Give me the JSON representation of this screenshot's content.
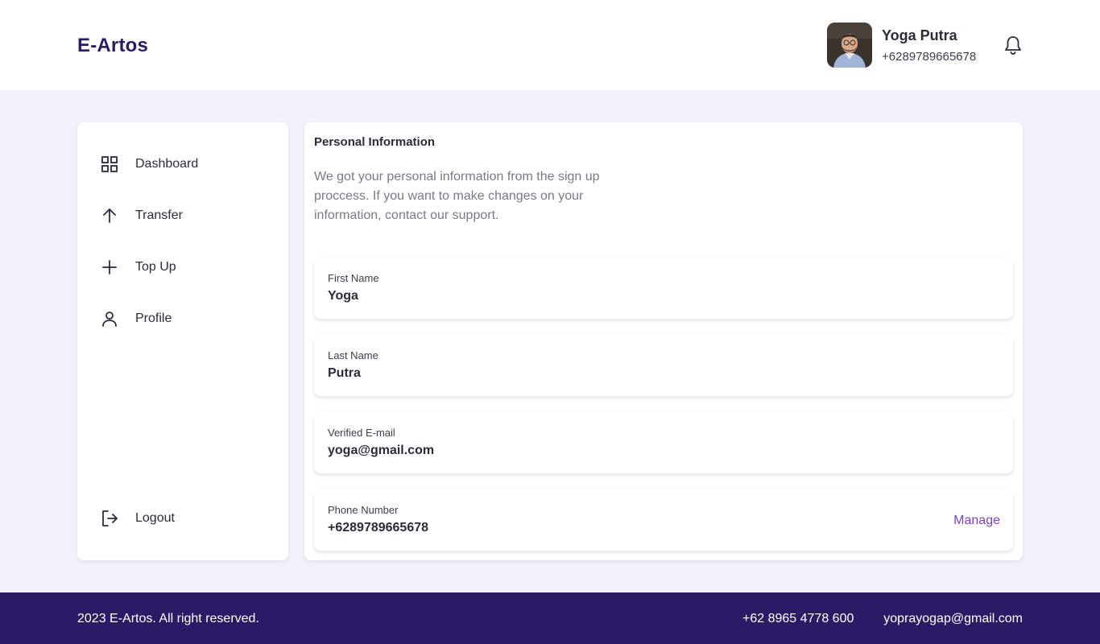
{
  "app": {
    "brand": "E-Artos"
  },
  "header": {
    "user": {
      "name": "Yoga Putra",
      "phone": "+6289789665678"
    },
    "icons": {
      "notification": "bell-icon"
    }
  },
  "sidebar": {
    "items": [
      {
        "label": "Dashboard",
        "icon": "grid-icon"
      },
      {
        "label": "Transfer",
        "icon": "arrow-up-icon"
      },
      {
        "label": "Top Up",
        "icon": "plus-icon"
      },
      {
        "label": "Profile",
        "icon": "user-icon"
      }
    ],
    "logout": {
      "label": "Logout",
      "icon": "logout-icon"
    }
  },
  "personal_info": {
    "title": "Personal Information",
    "description": "We got your personal information from the sign up proccess. If you want to make changes on your information, contact our support.",
    "fields": [
      {
        "label": "First Name",
        "value": "Yoga"
      },
      {
        "label": "Last Name",
        "value": "Putra"
      },
      {
        "label": "Verified E-mail",
        "value": "yoga@gmail.com"
      },
      {
        "label": "Phone Number",
        "value": "+6289789665678",
        "action": "Manage"
      }
    ]
  },
  "footer": {
    "copyright": "2023 E-Artos. All right reserved.",
    "phone": "+62 8965 4778 600",
    "email": "yoprayogap@gmail.com"
  },
  "colors": {
    "brand": "#2c1a66",
    "background": "#f3f1fb",
    "accent_link": "#7a3fcf",
    "footer_bg": "#2c1a66"
  }
}
